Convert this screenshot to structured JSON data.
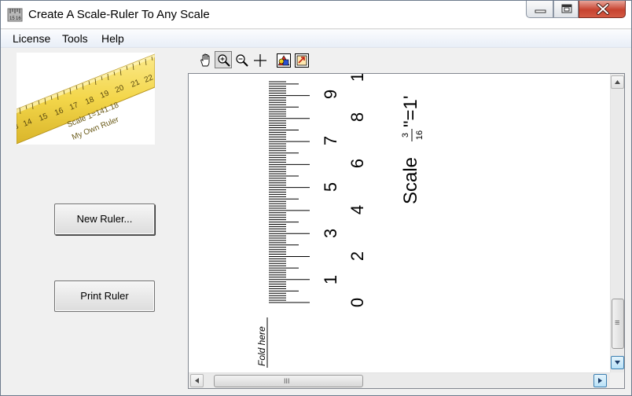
{
  "window": {
    "title": "Create A Scale-Ruler To Any Scale"
  },
  "menu": {
    "items": [
      "License",
      "Tools",
      "Help"
    ]
  },
  "logo": {
    "numbers": [
      "3",
      "14",
      "15",
      "16",
      "17",
      "18",
      "19",
      "20",
      "21",
      "22"
    ],
    "scale_text": "Scale 1=141.18",
    "caption": "My Own Ruler"
  },
  "buttons": {
    "new_ruler": "New Ruler...",
    "print_ruler": "Print Ruler"
  },
  "toolbar": {
    "tools": [
      "hand-icon",
      "zoom-in-icon",
      "zoom-out-icon",
      "crosshair-icon",
      "colors-icon",
      "export-icon"
    ],
    "active": "zoom-in-icon"
  },
  "ruler": {
    "numbers": [
      "0",
      "1",
      "2",
      "3",
      "4",
      "5",
      "6",
      "7",
      "8",
      "9",
      "1"
    ],
    "scale_word": "Scale",
    "fraction_numerator": "3",
    "fraction_denominator": "16",
    "scale_suffix": "\"=1'",
    "fold_label": "Fold here"
  },
  "scrollbar": {
    "horizontal_grip": "III",
    "vertical_grip": "≡"
  },
  "colors": {
    "ruler_yellow": "#f3d64a",
    "close_red": "#c7432f",
    "hot_blue": "#3c7fb1"
  }
}
